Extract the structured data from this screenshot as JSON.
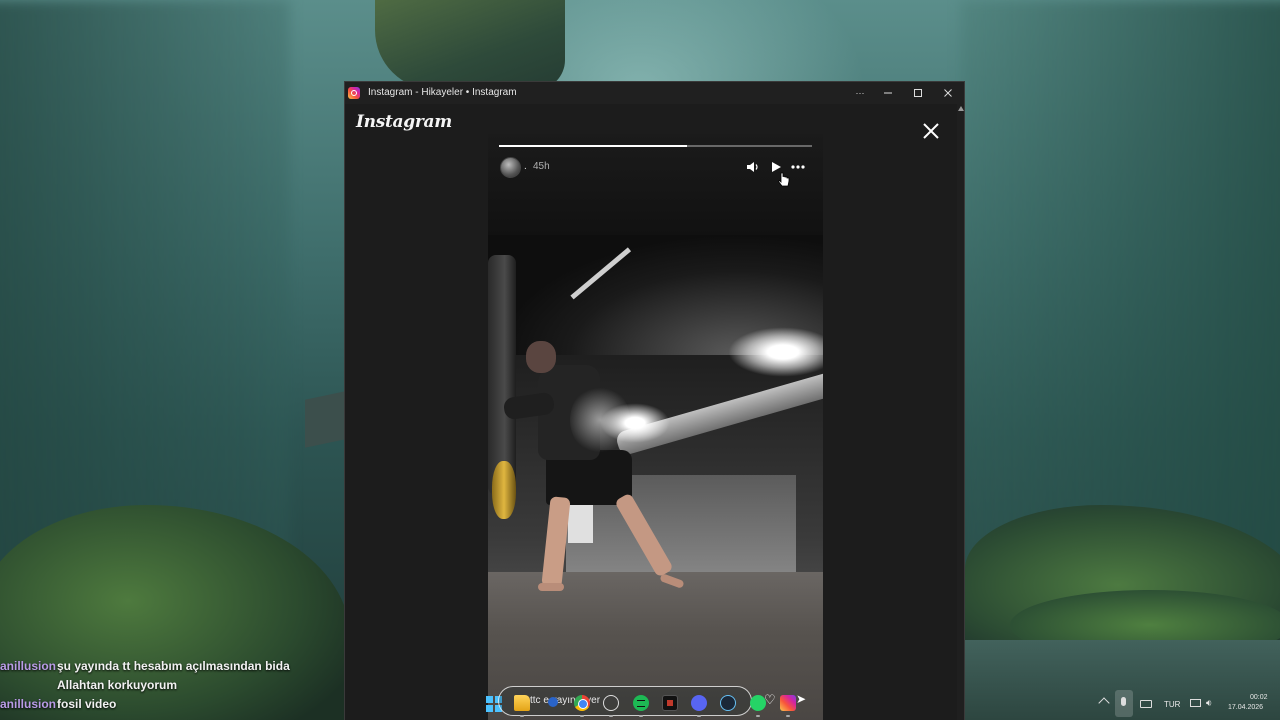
{
  "window": {
    "title": "Instagram - Hikayeler • Instagram",
    "more_label": "···"
  },
  "instagram": {
    "logo_text": "Instagram"
  },
  "story": {
    "username": ".",
    "time_ago": "45h",
    "progress_fraction": 0.6
  },
  "chat": [
    {
      "user": "anillusion",
      "text": "şu yayında tt hesabım açılmasından bida"
    },
    {
      "user": "",
      "text": "Allahtan korkuyorum"
    },
    {
      "user": "anillusion",
      "text": "fosil video"
    }
  ],
  "taskbar": {
    "search_text": "ttc   e yayıncı   ver"
  },
  "tray": {
    "language": "TUR",
    "time": "00:02",
    "date": "17.04.2026"
  }
}
